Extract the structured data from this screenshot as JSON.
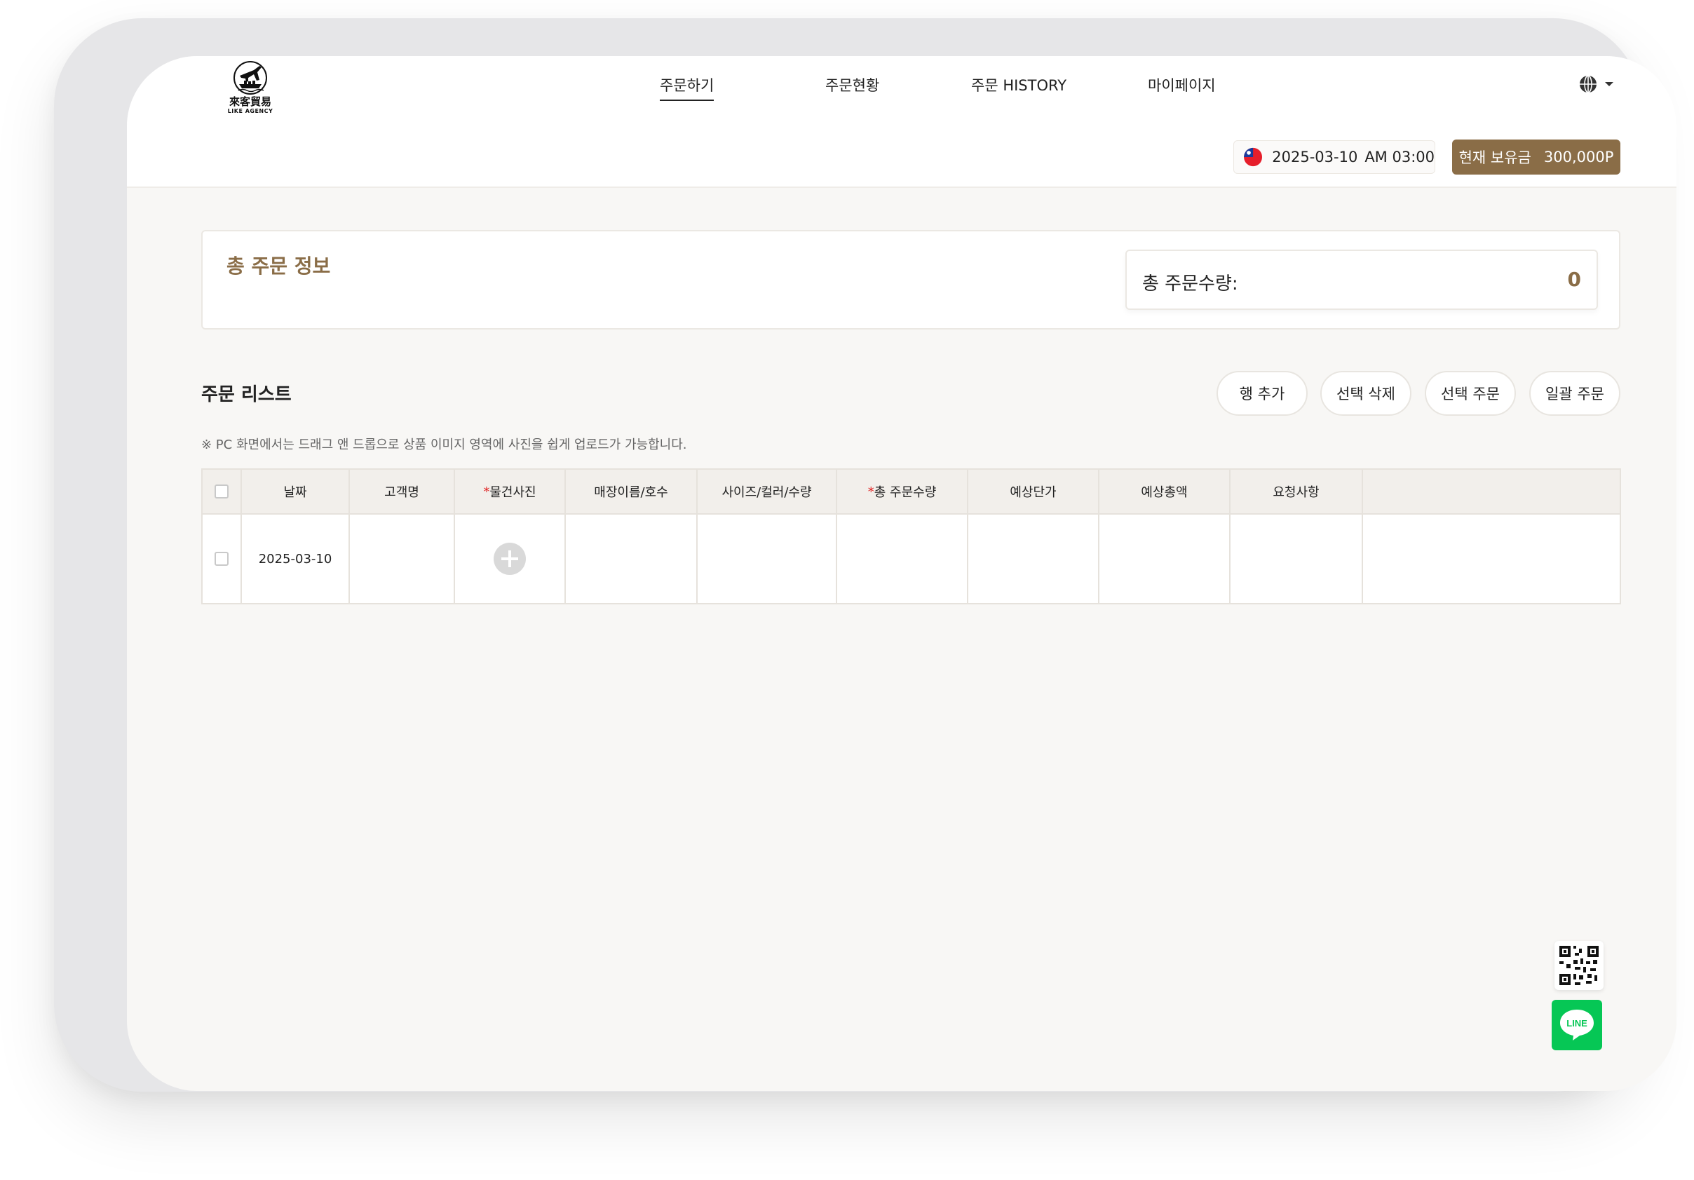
{
  "brand": {
    "name_cn": "來客貿易",
    "name_en": "LIKE AGENCY"
  },
  "nav": {
    "items": [
      {
        "label": "주문하기",
        "active": true
      },
      {
        "label": "주문현황",
        "active": false
      },
      {
        "label": "주문 HISTORY",
        "active": false
      },
      {
        "label": "마이페이지",
        "active": false
      }
    ]
  },
  "language": {
    "icon": "globe-icon"
  },
  "clock": {
    "date": "2025-03-10",
    "time": "AM 03:00",
    "flag": "taiwan-flag-icon"
  },
  "points": {
    "label": "현재 보유금",
    "value": "300,000P"
  },
  "summary": {
    "title": "총 주문 정보",
    "total_qty_label": "총 주문수량:",
    "total_qty_value": "0"
  },
  "order_list": {
    "title": "주문 리스트",
    "buttons": {
      "add_row": "행 추가",
      "delete_selected": "선택 삭제",
      "order_selected": "선택 주문",
      "order_all": "일괄 주문"
    },
    "notice": "※ PC 화면에서는 드래그 앤 드롭으로 상품 이미지 영역에 사진을 쉽게 업로드가 가능합니다.",
    "columns": [
      {
        "label": "날짜",
        "required": false
      },
      {
        "label": "고객명",
        "required": false
      },
      {
        "label": "물건사진",
        "required": true
      },
      {
        "label": "매장이름/호수",
        "required": false
      },
      {
        "label": "사이즈/컬러/수량",
        "required": false
      },
      {
        "label": "총 주문수량",
        "required": true
      },
      {
        "label": "예상단가",
        "required": false
      },
      {
        "label": "예상총액",
        "required": false
      },
      {
        "label": "요청사항",
        "required": false
      }
    ],
    "rows": [
      {
        "date": "2025-03-10",
        "customer": "",
        "store": "",
        "size_color_qty": "",
        "total_qty": "",
        "unit_price": "",
        "total_price": "",
        "request": ""
      }
    ],
    "required_mark": "*"
  },
  "colors": {
    "accent": "#8a6d47",
    "line": "#06c755",
    "required": "#e02424"
  }
}
